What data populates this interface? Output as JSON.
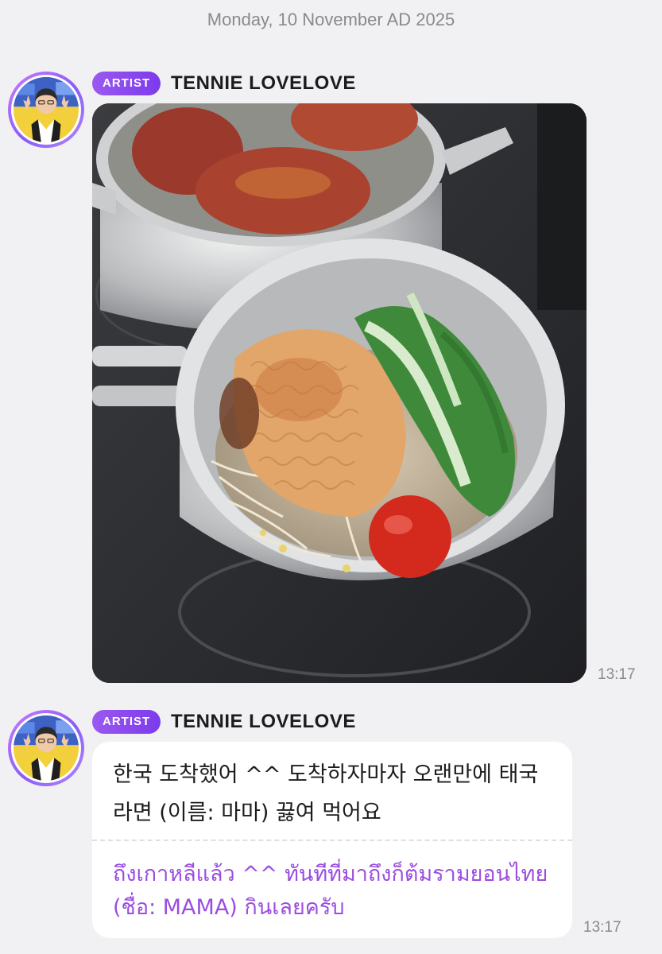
{
  "date_header": "Monday, 10 November AD 2025",
  "messages": [
    {
      "badge": "ARTIST",
      "sender": "TENNIE LOVELOVE",
      "type": "image",
      "image_description": "ramen-pot-photo",
      "time": "13:17"
    },
    {
      "badge": "ARTIST",
      "sender": "TENNIE LOVELOVE",
      "type": "text",
      "text_korean": "한국 도착했어 ^^ 도착하자마자 오랜만에 태국 라면 (이름: 마마) 끓여 먹어요",
      "text_thai": "ถึงเกาหลีแล้ว ^^ ทันทีที่มาถึงก็ต้มรามยอนไทย (ชื่อ: MAMA) กินเลยครับ",
      "time": "13:17"
    }
  ],
  "colors": {
    "background": "#f1f1f3",
    "badge": "#8b5cf6",
    "translation_text": "#9b4de0",
    "timestamp": "#8a8a8e"
  },
  "icons": [
    "artist-avatar-icon",
    "photo-image"
  ]
}
